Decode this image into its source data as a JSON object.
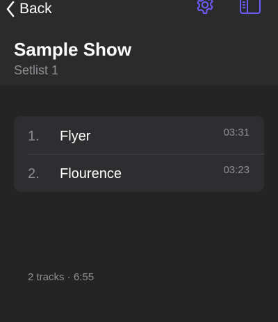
{
  "nav": {
    "back_label": "Back",
    "icons": {
      "back": "chevron-left-icon",
      "settings": "gear-icon",
      "sidebar": "sidebar-icon"
    }
  },
  "header": {
    "title": "Sample Show",
    "subtitle": "Setlist 1"
  },
  "tracks": [
    {
      "number": "1.",
      "name": "Flyer",
      "duration": "03:31"
    },
    {
      "number": "2.",
      "name": "Flourence",
      "duration": "03:23"
    }
  ],
  "footer": {
    "summary": "2 tracks · 6:55"
  },
  "colors": {
    "accent": "#6e5bff",
    "background": "#242424",
    "header_background": "#2b2b2b",
    "card_background": "#2e2e30",
    "secondary_text": "#8e8e93"
  }
}
